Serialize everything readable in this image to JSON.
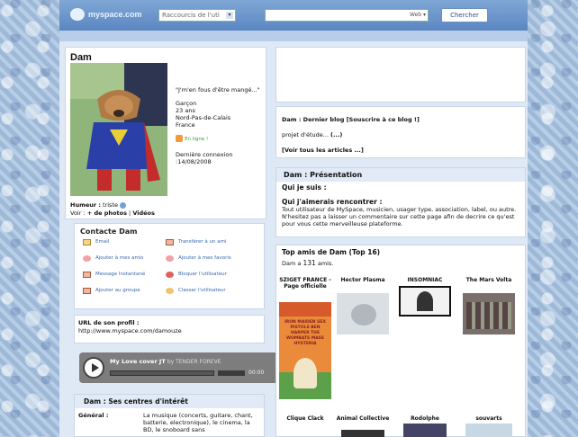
{
  "header": {
    "logo": "myspace.com",
    "shortcut_placeholder": "Raccourcis de l'uti",
    "search_option": "Web",
    "search_button": "Chercher"
  },
  "profile": {
    "name": "Dam",
    "quote": "\"J'm'en fous d'être mangé...\"",
    "gender": "Garçon",
    "age": "23 ans",
    "region": "Nord-Pas-de-Calais",
    "country": "France",
    "online": "En ligne !",
    "last_login_label": "Dernière connexion :",
    "last_login_date": "14/08/2008",
    "mood_label": "Humeur :",
    "mood_value": "triste",
    "view_label": "Voir :",
    "photos_link": "+ de photos",
    "separator": "|",
    "videos_link": "Vidéos"
  },
  "contact": {
    "title": "Contacte Dam",
    "items": [
      {
        "label": "Email",
        "icon": "email-icon"
      },
      {
        "label": "Transférer à un ami",
        "icon": "forward-icon"
      },
      {
        "label": "Ajouter à mes amis",
        "icon": "add-friend-icon"
      },
      {
        "label": "Ajouter à mes favoris",
        "icon": "favorite-icon"
      },
      {
        "label": "Message Instantané",
        "icon": "im-icon"
      },
      {
        "label": "Bloquer l'utilisateur",
        "icon": "block-icon"
      },
      {
        "label": "Ajouter au groupe",
        "icon": "group-icon"
      },
      {
        "label": "Classer l'utilisateur",
        "icon": "rank-icon"
      }
    ]
  },
  "url_box": {
    "title": "URL de son profil :",
    "url": "http://www.myspace.com/damouze"
  },
  "player": {
    "track": "My Love cover JT",
    "artist": "by TENDER FOREVE",
    "time": "00:00"
  },
  "interests": {
    "title": "Dam : Ses centres d'intérêt",
    "key": "Général :",
    "value": "La musique (concerts, guitare, chant, batterie, electronique), le cinema, la BD, le snoboard sans"
  },
  "blog": {
    "title": "Dam : Dernier blog",
    "subscribe": "[Souscrire à ce blog !]",
    "entry": "projet d'étude...",
    "more": "(...)",
    "all_articles": "[Voir tous les articles ...]"
  },
  "presentation": {
    "title": "Dam : Présentation",
    "who": "Qui je suis :",
    "meet": "Qui j'aimerais rencontrer :",
    "meet_text": "Tout utilisateur de MySpace, musicien, usager type, association, label, ou autre. N'hesitez pas a laisser un commentaire sur cette page afin de decrire ce qu'est pour vous cette merveilleuse plateforme."
  },
  "friends": {
    "title": "Top amis de Dam (Top 16)",
    "count_prefix": "Dam a",
    "count": "131",
    "count_suffix": "amis.",
    "row1": [
      "SZIGET FRANCE - Page officielle",
      "Hector Plasma",
      "INSOMNIAC",
      "The Mars Volta"
    ],
    "row2": [
      "Clique Clack",
      "Animal Collective",
      "Rodolphe",
      "souvarts"
    ],
    "poster_text": "IRON MAIDEN SEX PISTOLS BEN HARPER THE WOMBATS MASS HYSTERIA"
  }
}
